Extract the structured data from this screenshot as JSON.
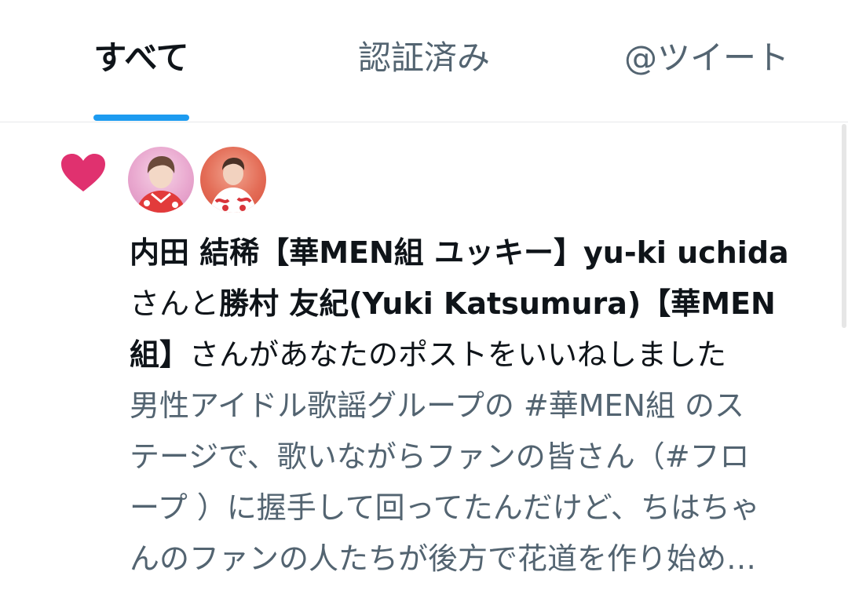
{
  "tabs": [
    {
      "label": "すべて",
      "active": true
    },
    {
      "label": "認証済み",
      "active": false
    },
    {
      "label": "@ツイート",
      "active": false
    }
  ],
  "notification": {
    "icon": "heart-icon",
    "icon_color": "#e0316f",
    "lines": {
      "l1_name1": "内田 結稀【華MEN組 ユッキー】yu-ki uchida",
      "l2_san_to": "さんと",
      "l2_name2": "勝村 友紀(Yuki Katsumura)【華MEN",
      "l3_name2_end": "組】",
      "l3_action": "さんがあなたのポストをいいねしました"
    },
    "post_preview_lines": [
      "男性アイドル歌謡グループの #華MEN組 のス",
      "テージで、歌いながらファンの皆さん（#フロ",
      "ープ ）に握手して回ってたんだけど、ちはちゃ",
      "んのファンの人たちが後方で花道を作り始め…"
    ]
  },
  "colors": {
    "accent": "#1d9bf0",
    "heart": "#e0316f",
    "text_primary": "#0f1419",
    "text_secondary": "#536471"
  }
}
